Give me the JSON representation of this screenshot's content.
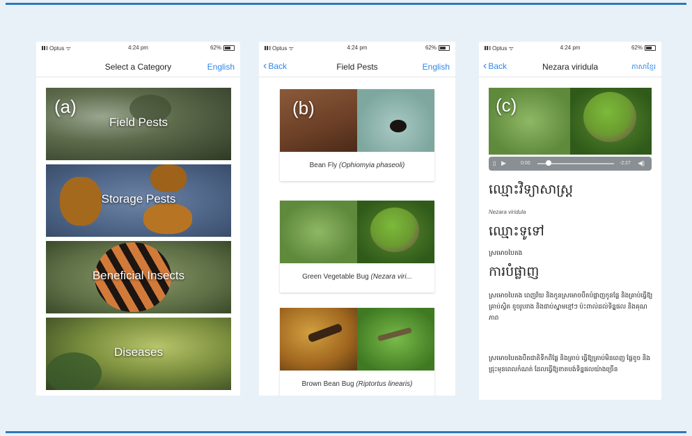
{
  "status_bar": {
    "carrier": "Optus",
    "time": "4:24 pm",
    "battery": "62%"
  },
  "screen_a": {
    "title": "Select a Category",
    "language": "English",
    "panel_letter": "(a)",
    "categories": [
      "Field Pests",
      "Storage Pests",
      "Beneficial Insects",
      "Diseases"
    ]
  },
  "screen_b": {
    "back_label": "Back",
    "title": "Field Pests",
    "language": "English",
    "panel_letter": "(b)",
    "pests": [
      {
        "common": "Bean Fly",
        "scientific": "(Ophiomyia phaseoli)"
      },
      {
        "common": "Green Vegetable Bug",
        "scientific": "(Nezara viri..."
      },
      {
        "common": "Brown Bean Bug",
        "scientific": "(Riptortus linearis)"
      }
    ]
  },
  "screen_c": {
    "back_label": "Back",
    "title": "Nezara viridula",
    "language": "ភាសាខ្មែរ",
    "panel_letter": "(c)",
    "audio": {
      "elapsed": "0:00",
      "remaining": "-2:27"
    },
    "scientific_heading": "ឈ្មោះវិទ្យាសាស្ត្រ",
    "scientific_value": "Nezara viridula",
    "common_heading": "ឈ្មោះទូទៅ",
    "common_value": "ស្រមោចបៃតង",
    "damage_heading": "ការបំផ្លាញ",
    "paragraph_1": "ស្រមោចបៃតង ពេញវ័យ និងកូនស្រមោចបឺតបំផ្លាញកូនផ្លែ និងគ្រាប់ធ្វើឱ្យគ្រាប់ស្វិត ខូចរូបរាង និងជាប់ស្នាមខ្មៅៗ ប៉ះពាល់ដល់ទិន្នផល និងគុណភាព",
    "paragraph_2": "ស្រមោចបៃតងបឺតជាតិទឹកពីផ្លែ និងគ្រាប់ ធ្វើឱ្យគ្រាប់មិនពេញ ផ្លែខូច និងជ្រុះមុនពេលកំណត់ ដែលធ្វើឱ្យខាតបង់ទិន្នផលយ៉ាងច្រើន"
  }
}
